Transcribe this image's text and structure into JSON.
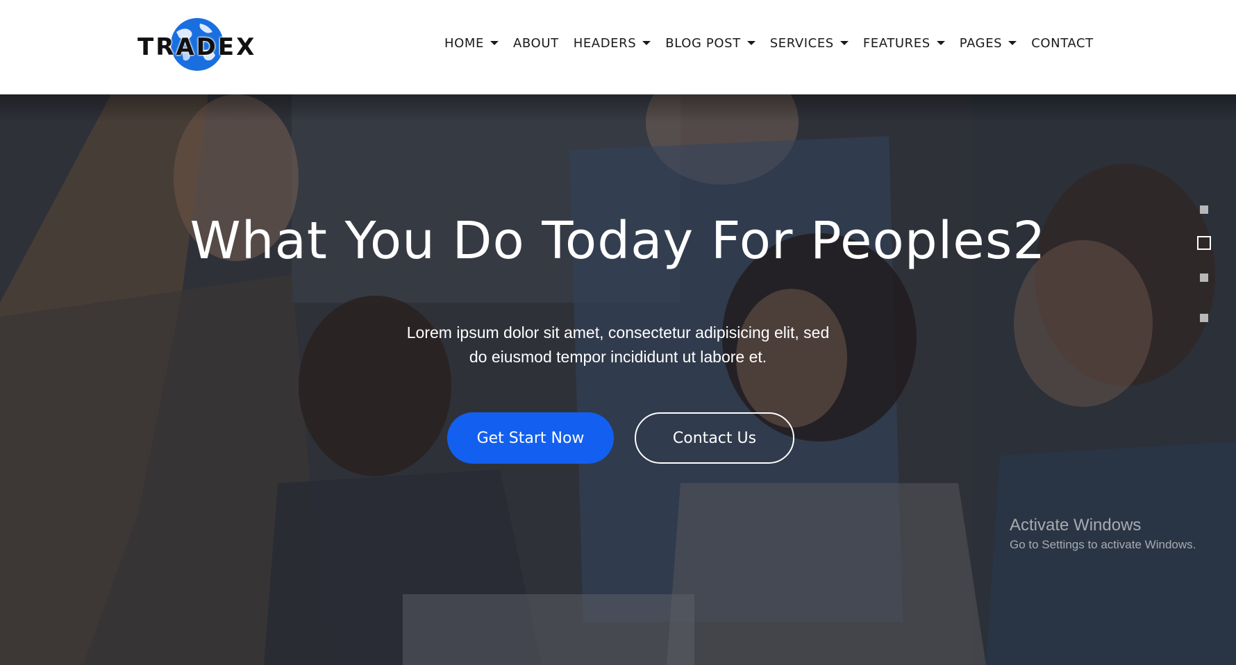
{
  "brand": {
    "name": "TRADEX",
    "logo_icon": "globe-icon",
    "globe_color": "#1a6fe0"
  },
  "nav": {
    "items": [
      {
        "label": "HOME",
        "has_dropdown": true
      },
      {
        "label": "ABOUT",
        "has_dropdown": false
      },
      {
        "label": "HEADERS",
        "has_dropdown": true
      },
      {
        "label": "BLOG POST",
        "has_dropdown": true
      },
      {
        "label": "SERVICES",
        "has_dropdown": true
      },
      {
        "label": "FEATURES",
        "has_dropdown": true
      },
      {
        "label": "PAGES",
        "has_dropdown": true
      },
      {
        "label": "CONTACT",
        "has_dropdown": false
      }
    ]
  },
  "hero": {
    "title": "What You Do Today For Peoples2",
    "text_line1": "Lorem ipsum dolor sit amet, consectetur adipisicing elit, sed",
    "text_line2": "do eiusmod tempor incididunt ut labore et.",
    "primary_button": "Get Start Now",
    "secondary_button": "Contact Us",
    "slider": {
      "count": 4,
      "active_index": 1
    }
  },
  "colors": {
    "primary": "#1360f0",
    "text_dark": "#1a1a1a",
    "overlay": "#14161c"
  },
  "watermark": {
    "title": "Activate Windows",
    "subtitle": "Go to Settings to activate Windows."
  }
}
